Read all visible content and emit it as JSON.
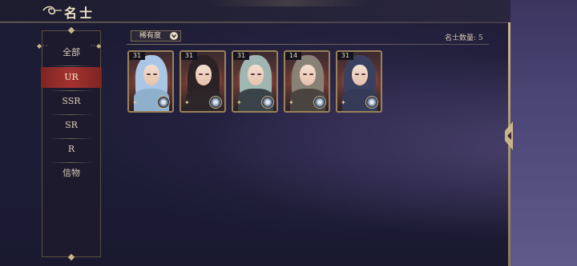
{
  "header": {
    "title": "名士"
  },
  "sidebar": {
    "tabs": [
      {
        "label": "全部",
        "selected": false
      },
      {
        "label": "UR",
        "selected": true
      },
      {
        "label": "SSR",
        "selected": false
      },
      {
        "label": "SR",
        "selected": false
      },
      {
        "label": "R",
        "selected": false
      },
      {
        "label": "信物",
        "selected": false
      }
    ]
  },
  "filter": {
    "label": "稀有度",
    "icon": "chevron-down-icon"
  },
  "summary": {
    "count_text": "名士数量: 5"
  },
  "cards": [
    {
      "level": "31",
      "hair_color": "#a9c6e6",
      "body_color": "#8fb0cc"
    },
    {
      "level": "31",
      "hair_color": "#2a2224",
      "body_color": "#2c2628"
    },
    {
      "level": "31",
      "hair_color": "#9fb6b2",
      "body_color": "#3a4448"
    },
    {
      "level": "14",
      "hair_color": "#8a8176",
      "body_color": "#4a4440"
    },
    {
      "level": "31",
      "hair_color": "#3a4060",
      "body_color": "#343a58"
    }
  ],
  "colors": {
    "accent_red": "#a43330",
    "gold_trim": "#c8b58b",
    "panel_bg": "#1c1a2c"
  }
}
